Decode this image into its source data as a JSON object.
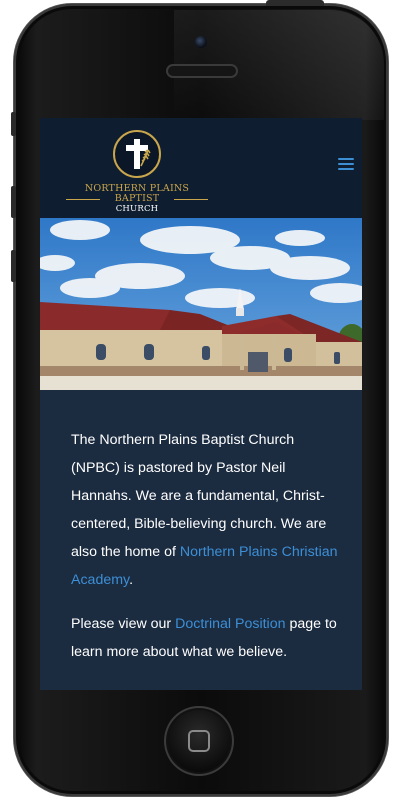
{
  "site": {
    "logo_line1": "NORTHERN PLAINS BAPTIST",
    "logo_line2": "CHURCH",
    "menu_icon": "hamburger-icon",
    "hero_image": "photo of church building with steeple under blue sky"
  },
  "content": {
    "para1_text": "The Northern Plains Baptist Church (NPBC) is pastored by Pastor Neil Hannahs. We are a fundamental, Christ-centered, Bible-believing church. We are also the home of ",
    "para1_link": "Northern Plains Christian Academy",
    "para1_end": ".",
    "para2_start": "Please view our ",
    "para2_link": "Doctrinal Position",
    "para2_end": " page to learn more about what we believe."
  },
  "colors": {
    "header_bg": "#0f1d30",
    "content_bg": "#1b2b40",
    "gold": "#c9a64c",
    "link": "#3d8fd6"
  }
}
